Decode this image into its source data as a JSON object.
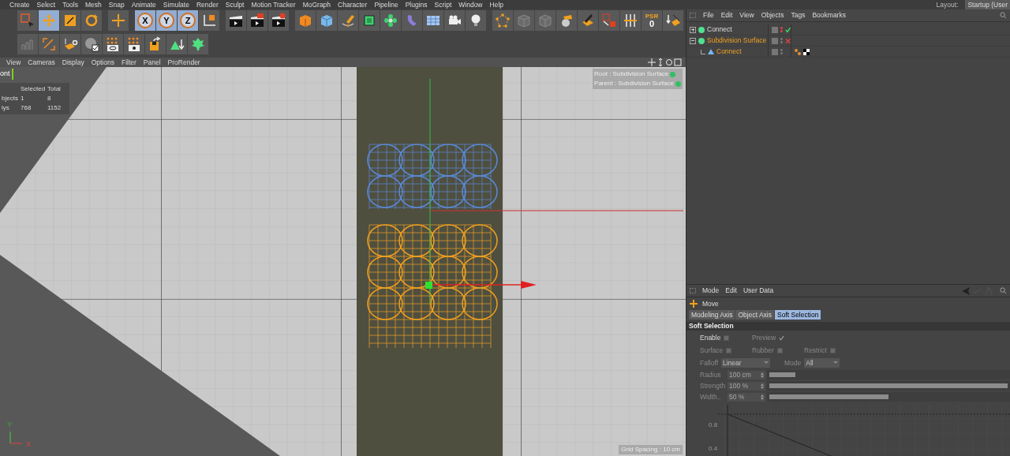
{
  "menu_bar": {
    "items": [
      "Create",
      "Select",
      "Tools",
      "Mesh",
      "Snap",
      "Animate",
      "Simulate",
      "Render",
      "Sculpt",
      "Motion Tracker",
      "MoGraph",
      "Character",
      "Pipeline",
      "Plugins",
      "Script",
      "Window",
      "Help"
    ],
    "layout_label": "Layout:",
    "layout_value": "Startup (User"
  },
  "toolbar": {
    "row_1": [
      [
        {
          "kind": "selection-square",
          "selected": false
        },
        {
          "kind": "cross-arrows",
          "selected": true
        },
        {
          "kind": "scale-square",
          "selected": false
        },
        {
          "kind": "circular-arrows",
          "selected": false
        }
      ],
      [
        {
          "kind": "plus-arrows",
          "selected": false
        }
      ],
      [
        {
          "kind": "axis-letter",
          "label": "X",
          "selected": true
        },
        {
          "kind": "axis-letter",
          "label": "Y",
          "selected": true
        },
        {
          "kind": "axis-letter",
          "label": "Z",
          "selected": true
        },
        {
          "kind": "axis-cube",
          "selected": false
        }
      ],
      [
        {
          "kind": "clapboard",
          "selected": false
        },
        {
          "kind": "clapboard-picture",
          "selected": false
        },
        {
          "kind": "clapboard-gear",
          "selected": false
        }
      ],
      [
        {
          "kind": "solid-cube",
          "selected": false
        },
        {
          "kind": "cube",
          "selected": false
        },
        {
          "kind": "pen-curve",
          "selected": false
        },
        {
          "kind": "framed-cube",
          "selected": false
        },
        {
          "kind": "flower",
          "selected": false
        },
        {
          "kind": "bent-tube",
          "selected": false
        },
        {
          "kind": "grid-plane",
          "selected": false
        },
        {
          "kind": "movie-camera",
          "selected": false
        },
        {
          "kind": "light-bulb",
          "selected": false
        }
      ],
      [
        {
          "kind": "points-pentagon",
          "selected": false
        },
        {
          "kind": "cube-outline",
          "selected": false
        },
        {
          "kind": "box-outline",
          "selected": false
        },
        {
          "kind": "brush-blob",
          "selected": false
        },
        {
          "kind": "pen-paper",
          "selected": false
        },
        {
          "kind": "grid-arrow-square",
          "selected": false
        },
        {
          "kind": "sliders",
          "selected": false
        },
        {
          "kind": "psr",
          "label": "PSR",
          "value": "0",
          "selected": false
        },
        {
          "kind": "arrow-plane",
          "selected": false
        }
      ]
    ],
    "row_2": [
      [
        {
          "kind": "bar-chart",
          "selected": false
        },
        {
          "kind": "corner-brackets",
          "selected": false
        },
        {
          "kind": "plane-gear",
          "selected": false
        },
        {
          "kind": "sphere-check",
          "selected": false
        },
        {
          "kind": "dots-ellipse",
          "selected": false
        },
        {
          "kind": "dots-eye",
          "selected": false
        },
        {
          "kind": "floppy-arrow",
          "selected": false
        },
        {
          "kind": "triangle-arrow",
          "selected": false
        },
        {
          "kind": "leaf",
          "selected": false
        }
      ]
    ]
  },
  "viewport": {
    "menu": [
      "View",
      "Cameras",
      "Display",
      "Options",
      "Filter",
      "Panel",
      "ProRender"
    ],
    "camera_label": "ont",
    "stats": {
      "headers": [
        "Selected",
        "Total"
      ],
      "rows": [
        {
          "label": "bjects",
          "selected": "1",
          "total": "8"
        },
        {
          "label": "lys",
          "selected": "768",
          "total": "1152"
        }
      ]
    },
    "hud": [
      "Root : Subdivision Surface",
      "Parent : Subdivision Surface"
    ],
    "grid_spacing": "Grid Spacing : 10 cm",
    "axis_labels": [
      "Y",
      "X"
    ]
  },
  "object_manager": {
    "menu": [
      "File",
      "Edit",
      "View",
      "Objects",
      "Tags",
      "Bookmarks"
    ],
    "objects": [
      {
        "name": "Connect",
        "selected": false,
        "expanded": false,
        "hidden": true,
        "enabled": true
      },
      {
        "name": "Subdivision Surface",
        "selected": true,
        "expanded": true,
        "hidden": false,
        "enabled": false,
        "children": [
          {
            "name": "Connect",
            "selected": true,
            "hidden": false,
            "tags": [
              {
                "kind": "phong"
              },
              {
                "kind": "checker"
              }
            ]
          }
        ]
      }
    ]
  },
  "attributes": {
    "menu": [
      "Mode",
      "Edit",
      "User Data"
    ],
    "tool_name": "Move",
    "tabs": [
      {
        "label": "Modeling Axis",
        "selected": false
      },
      {
        "label": "Object Axis",
        "selected": false
      },
      {
        "label": "Soft Selection",
        "selected": true
      }
    ],
    "section": "Soft Selection",
    "options": [
      [
        {
          "label": "Enable",
          "checked": false,
          "disabled": false
        },
        {
          "label": "Preview",
          "checked": true,
          "disabled": true
        }
      ],
      [
        {
          "label": "Surface",
          "checked": false,
          "disabled": true
        },
        {
          "label": "Rubber",
          "checked": false,
          "disabled": true
        },
        {
          "label": "Restrict",
          "checked": false,
          "disabled": true
        }
      ]
    ],
    "dropdowns": [
      {
        "label": "Falloff",
        "value": "Linear"
      },
      {
        "label": "Mode",
        "value": "All"
      }
    ],
    "sliders": [
      {
        "label": "Radius",
        "value": "100 cm",
        "level": 0.11
      },
      {
        "label": "Strength",
        "value": "100 %",
        "level": 1
      },
      {
        "label": "Width..",
        "value": "50 %",
        "level": 0.5
      }
    ],
    "graph_tick_labels": [
      "0.8",
      "0.4"
    ]
  }
}
